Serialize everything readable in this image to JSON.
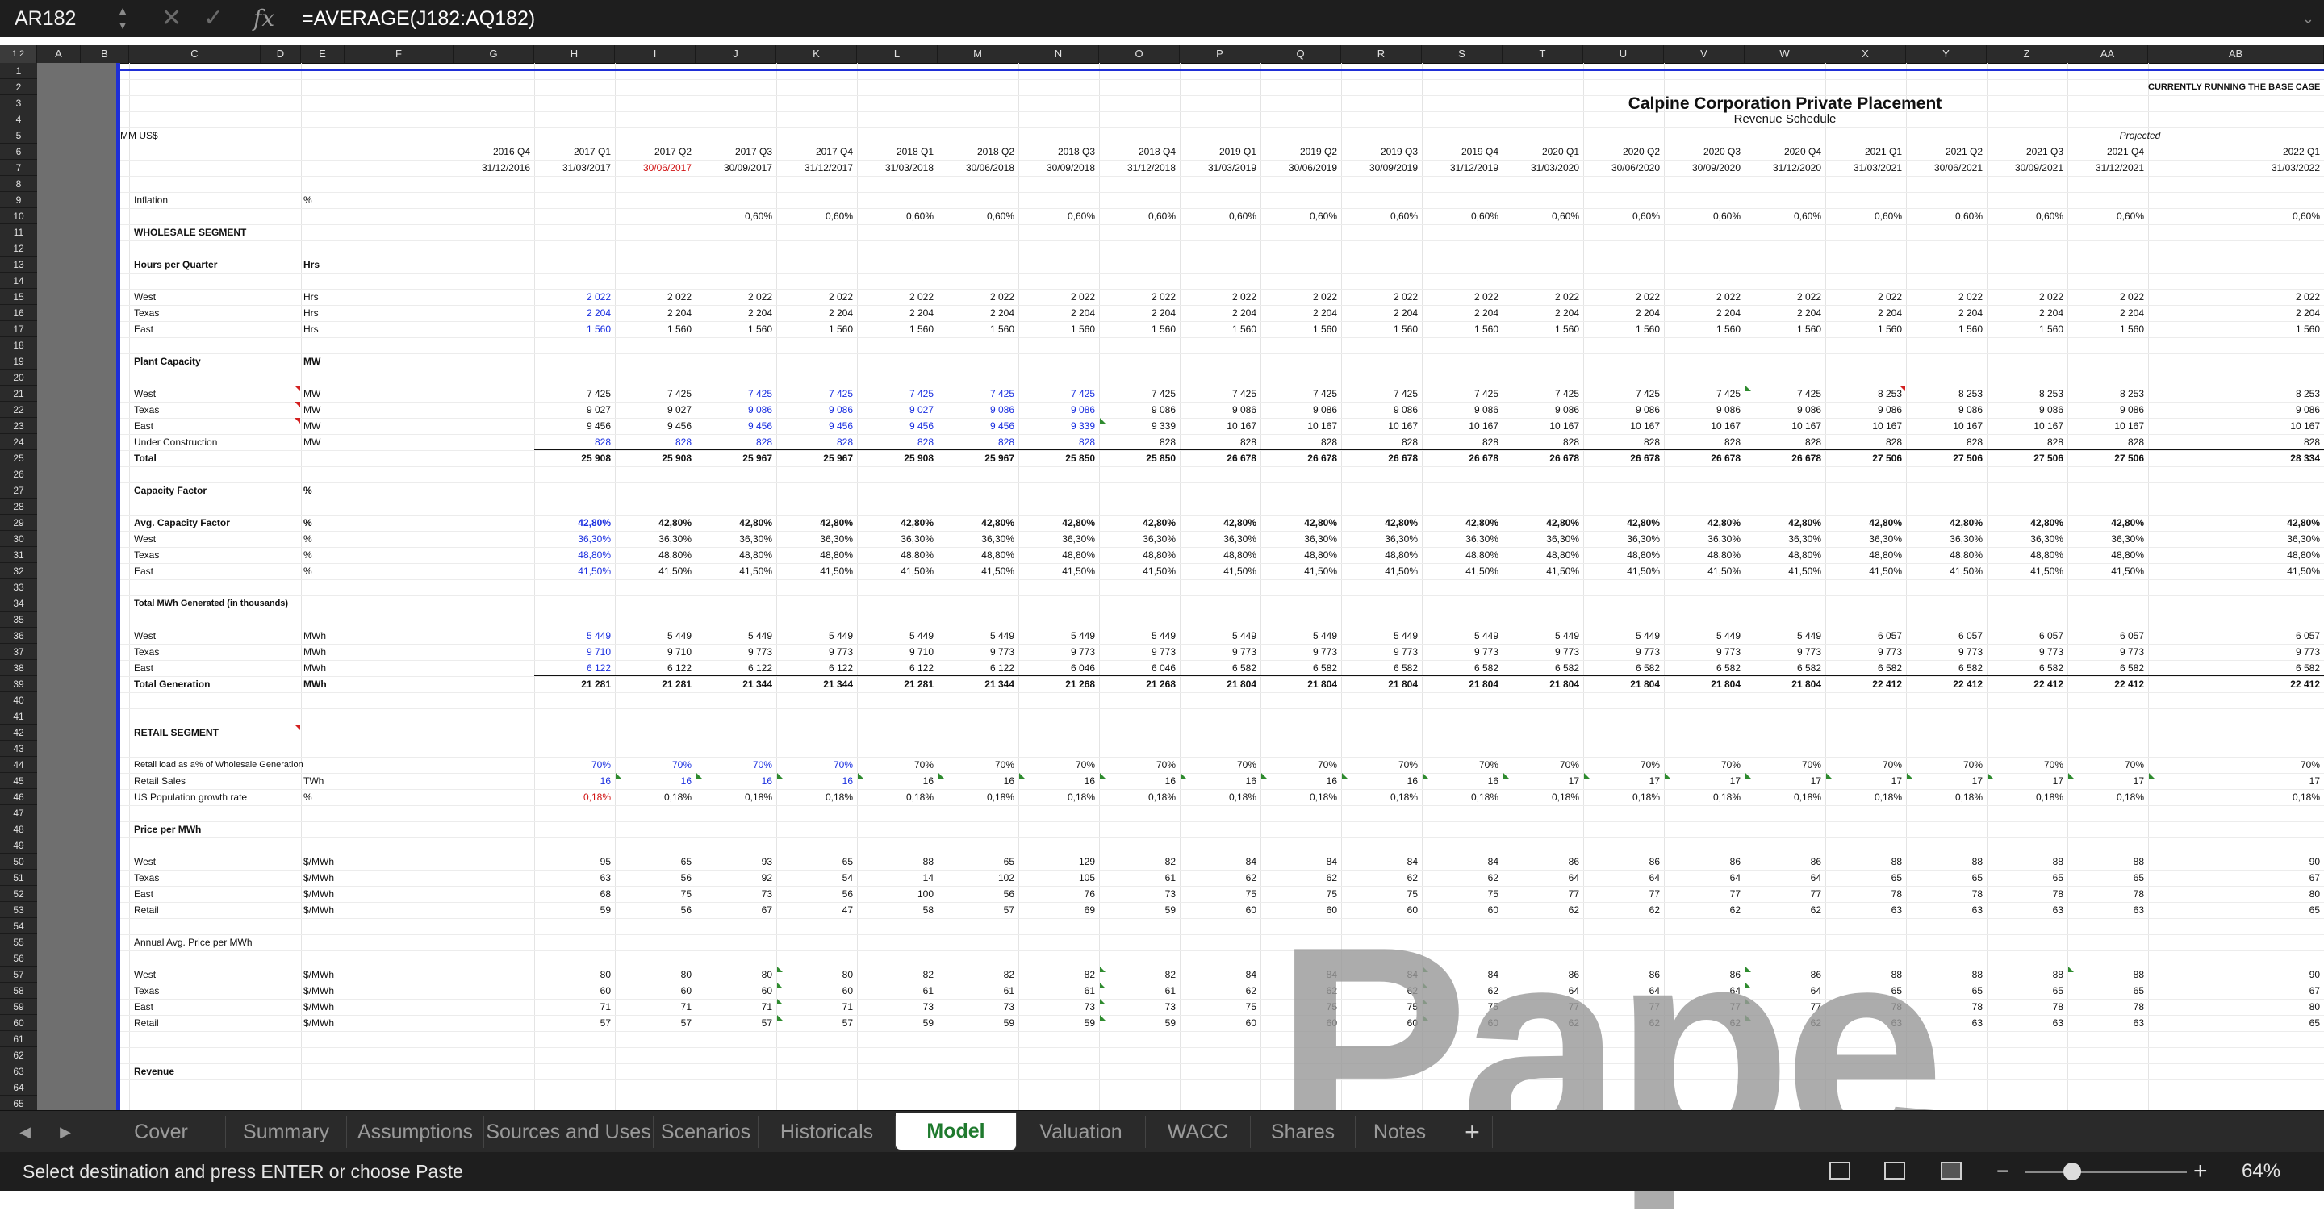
{
  "formula_bar": {
    "name_box": "AR182",
    "fx_label": "fx",
    "formula": "=AVERAGE(J182:AQ182)",
    "cancel_icon": "x-icon",
    "confirm_icon": "check-icon"
  },
  "outline_levels": "1 2",
  "columns": [
    "A",
    "B",
    "C",
    "D",
    "E",
    "F",
    "G",
    "H",
    "I",
    "J",
    "K",
    "L",
    "M",
    "N",
    "O",
    "P",
    "Q",
    "R",
    "S",
    "T",
    "U",
    "V",
    "W",
    "X",
    "Y",
    "Z",
    "AA",
    "AB"
  ],
  "headers": {
    "banner": "CURRENTLY RUNNING THE BASE CASE",
    "company": "Calpine Corporation Private Placement",
    "schedule": "Revenue Schedule",
    "units": "MM US$",
    "projected": "Projected",
    "periods": [
      "2016 Q4",
      "2017 Q1",
      "2017 Q2",
      "2017 Q3",
      "2017 Q4",
      "2018 Q1",
      "2018 Q2",
      "2018 Q3",
      "2018 Q4",
      "2019 Q1",
      "2019 Q2",
      "2019 Q3",
      "2019 Q4",
      "2020 Q1",
      "2020 Q2",
      "2020 Q3",
      "2020 Q4",
      "2021 Q1",
      "2021 Q2",
      "2021 Q3",
      "2021 Q4",
      "2022 Q1"
    ],
    "dates": [
      "31/12/2016",
      "31/03/2017",
      "30/06/2017",
      "30/09/2017",
      "31/12/2017",
      "31/03/2018",
      "30/06/2018",
      "30/09/2018",
      "31/12/2018",
      "31/03/2019",
      "30/06/2019",
      "30/09/2019",
      "31/12/2019",
      "31/03/2020",
      "30/06/2020",
      "30/09/2020",
      "31/12/2020",
      "31/03/2021",
      "30/06/2021",
      "30/09/2021",
      "31/12/2021",
      "31/03/2022"
    ]
  },
  "rows": [
    {
      "r": 9,
      "label": "Inflation",
      "unit": "%"
    },
    {
      "r": 10,
      "values": [
        "",
        "",
        "",
        "0,60%",
        "0,60%",
        "0,60%",
        "0,60%",
        "0,60%",
        "0,60%",
        "0,60%",
        "0,60%",
        "0,60%",
        "0,60%",
        "0,60%",
        "0,60%",
        "0,60%",
        "0,60%",
        "0,60%",
        "0,60%",
        "0,60%",
        "0,60%",
        "0,60%"
      ]
    },
    {
      "r": 11,
      "label": "WHOLESALE SEGMENT",
      "bold": true
    },
    {
      "r": 13,
      "label": "Hours per Quarter",
      "unit": "Hrs",
      "bold": true
    },
    {
      "r": 15,
      "label": "West",
      "unit": "Hrs",
      "values": [
        "",
        "2 022",
        "2 022",
        "2 022",
        "2 022",
        "2 022",
        "2 022",
        "2 022",
        "2 022",
        "2 022",
        "2 022",
        "2 022",
        "2 022",
        "2 022",
        "2 022",
        "2 022",
        "2 022",
        "2 022",
        "2 022",
        "2 022",
        "2 022",
        "2 022"
      ],
      "blue": [
        1
      ]
    },
    {
      "r": 16,
      "label": "Texas",
      "unit": "Hrs",
      "values": [
        "",
        "2 204",
        "2 204",
        "2 204",
        "2 204",
        "2 204",
        "2 204",
        "2 204",
        "2 204",
        "2 204",
        "2 204",
        "2 204",
        "2 204",
        "2 204",
        "2 204",
        "2 204",
        "2 204",
        "2 204",
        "2 204",
        "2 204",
        "2 204",
        "2 204"
      ],
      "blue": [
        1
      ]
    },
    {
      "r": 17,
      "label": "East",
      "unit": "Hrs",
      "values": [
        "",
        "1 560",
        "1 560",
        "1 560",
        "1 560",
        "1 560",
        "1 560",
        "1 560",
        "1 560",
        "1 560",
        "1 560",
        "1 560",
        "1 560",
        "1 560",
        "1 560",
        "1 560",
        "1 560",
        "1 560",
        "1 560",
        "1 560",
        "1 560",
        "1 560"
      ],
      "blue": [
        1
      ]
    },
    {
      "r": 19,
      "label": "Plant Capacity",
      "unit": "MW",
      "bold": true
    },
    {
      "r": 21,
      "label": "West",
      "unit": "MW",
      "values": [
        "",
        "7 425",
        "7 425",
        "7 425",
        "7 425",
        "7 425",
        "7 425",
        "7 425",
        "7 425",
        "7 425",
        "7 425",
        "7 425",
        "7 425",
        "7 425",
        "7 425",
        "7 425",
        "7 425",
        "8 253",
        "8 253",
        "8 253",
        "8 253",
        "8 253"
      ],
      "blue": [
        3,
        4,
        5,
        6,
        7
      ]
    },
    {
      "r": 22,
      "label": "Texas",
      "unit": "MW",
      "values": [
        "",
        "9 027",
        "9 027",
        "9 086",
        "9 086",
        "9 027",
        "9 086",
        "9 086",
        "9 086",
        "9 086",
        "9 086",
        "9 086",
        "9 086",
        "9 086",
        "9 086",
        "9 086",
        "9 086",
        "9 086",
        "9 086",
        "9 086",
        "9 086",
        "9 086"
      ],
      "blue": [
        3,
        4,
        5,
        6,
        7
      ]
    },
    {
      "r": 23,
      "label": "East",
      "unit": "MW",
      "values": [
        "",
        "9 456",
        "9 456",
        "9 456",
        "9 456",
        "9 456",
        "9 456",
        "9 339",
        "9 339",
        "10 167",
        "10 167",
        "10 167",
        "10 167",
        "10 167",
        "10 167",
        "10 167",
        "10 167",
        "10 167",
        "10 167",
        "10 167",
        "10 167",
        "10 167"
      ],
      "blue": [
        3,
        4,
        5,
        6,
        7
      ]
    },
    {
      "r": 24,
      "label": "Under Construction",
      "unit": "MW",
      "values": [
        "",
        "828",
        "828",
        "828",
        "828",
        "828",
        "828",
        "828",
        "828",
        "828",
        "828",
        "828",
        "828",
        "828",
        "828",
        "828",
        "828",
        "828",
        "828",
        "828",
        "828",
        "828"
      ],
      "blue": [
        1,
        2,
        3,
        4,
        5,
        6,
        7
      ]
    },
    {
      "r": 25,
      "label": "Total",
      "bold": true,
      "values": [
        "",
        "25 908",
        "25 908",
        "25 967",
        "25 967",
        "25 908",
        "25 967",
        "25 850",
        "25 850",
        "26 678",
        "26 678",
        "26 678",
        "26 678",
        "26 678",
        "26 678",
        "26 678",
        "26 678",
        "27 506",
        "27 506",
        "27 506",
        "27 506",
        "28 334"
      ]
    },
    {
      "r": 27,
      "label": "Capacity Factor",
      "unit": "%",
      "bold": true
    },
    {
      "r": 29,
      "label": "Avg. Capacity Factor",
      "unit": "%",
      "bold": true,
      "values": [
        "",
        "42,80%",
        "42,80%",
        "42,80%",
        "42,80%",
        "42,80%",
        "42,80%",
        "42,80%",
        "42,80%",
        "42,80%",
        "42,80%",
        "42,80%",
        "42,80%",
        "42,80%",
        "42,80%",
        "42,80%",
        "42,80%",
        "42,80%",
        "42,80%",
        "42,80%",
        "42,80%",
        "42,80%"
      ],
      "blue": [
        1
      ]
    },
    {
      "r": 30,
      "label": "West",
      "unit": "%",
      "values": [
        "",
        "36,30%",
        "36,30%",
        "36,30%",
        "36,30%",
        "36,30%",
        "36,30%",
        "36,30%",
        "36,30%",
        "36,30%",
        "36,30%",
        "36,30%",
        "36,30%",
        "36,30%",
        "36,30%",
        "36,30%",
        "36,30%",
        "36,30%",
        "36,30%",
        "36,30%",
        "36,30%",
        "36,30%"
      ],
      "blue": [
        1
      ]
    },
    {
      "r": 31,
      "label": "Texas",
      "unit": "%",
      "values": [
        "",
        "48,80%",
        "48,80%",
        "48,80%",
        "48,80%",
        "48,80%",
        "48,80%",
        "48,80%",
        "48,80%",
        "48,80%",
        "48,80%",
        "48,80%",
        "48,80%",
        "48,80%",
        "48,80%",
        "48,80%",
        "48,80%",
        "48,80%",
        "48,80%",
        "48,80%",
        "48,80%",
        "48,80%"
      ],
      "blue": [
        1
      ]
    },
    {
      "r": 32,
      "label": "East",
      "unit": "%",
      "values": [
        "",
        "41,50%",
        "41,50%",
        "41,50%",
        "41,50%",
        "41,50%",
        "41,50%",
        "41,50%",
        "41,50%",
        "41,50%",
        "41,50%",
        "41,50%",
        "41,50%",
        "41,50%",
        "41,50%",
        "41,50%",
        "41,50%",
        "41,50%",
        "41,50%",
        "41,50%",
        "41,50%",
        "41,50%"
      ],
      "blue": [
        1
      ]
    },
    {
      "r": 34,
      "label": "Total MWh Generated (in thousands)",
      "bold": true
    },
    {
      "r": 36,
      "label": "West",
      "unit": "MWh",
      "values": [
        "",
        "5 449",
        "5 449",
        "5 449",
        "5 449",
        "5 449",
        "5 449",
        "5 449",
        "5 449",
        "5 449",
        "5 449",
        "5 449",
        "5 449",
        "5 449",
        "5 449",
        "5 449",
        "5 449",
        "6 057",
        "6 057",
        "6 057",
        "6 057",
        "6 057"
      ],
      "blue": [
        1
      ]
    },
    {
      "r": 37,
      "label": "Texas",
      "unit": "MWh",
      "values": [
        "",
        "9 710",
        "9 710",
        "9 773",
        "9 773",
        "9 710",
        "9 773",
        "9 773",
        "9 773",
        "9 773",
        "9 773",
        "9 773",
        "9 773",
        "9 773",
        "9 773",
        "9 773",
        "9 773",
        "9 773",
        "9 773",
        "9 773",
        "9 773",
        "9 773"
      ],
      "blue": [
        1
      ]
    },
    {
      "r": 38,
      "label": "East",
      "unit": "MWh",
      "values": [
        "",
        "6 122",
        "6 122",
        "6 122",
        "6 122",
        "6 122",
        "6 122",
        "6 046",
        "6 046",
        "6 582",
        "6 582",
        "6 582",
        "6 582",
        "6 582",
        "6 582",
        "6 582",
        "6 582",
        "6 582",
        "6 582",
        "6 582",
        "6 582",
        "6 582"
      ],
      "blue": [
        1
      ]
    },
    {
      "r": 39,
      "label": "Total Generation",
      "unit": "MWh",
      "bold": true,
      "values": [
        "",
        "21 281",
        "21 281",
        "21 344",
        "21 344",
        "21 281",
        "21 344",
        "21 268",
        "21 268",
        "21 804",
        "21 804",
        "21 804",
        "21 804",
        "21 804",
        "21 804",
        "21 804",
        "21 804",
        "22 412",
        "22 412",
        "22 412",
        "22 412",
        "22 412"
      ]
    },
    {
      "r": 42,
      "label": "RETAIL SEGMENT",
      "bold": true
    },
    {
      "r": 44,
      "label": "Retail load as a% of Wholesale Generation",
      "values": [
        "",
        "70%",
        "70%",
        "70%",
        "70%",
        "70%",
        "70%",
        "70%",
        "70%",
        "70%",
        "70%",
        "70%",
        "70%",
        "70%",
        "70%",
        "70%",
        "70%",
        "70%",
        "70%",
        "70%",
        "70%",
        "70%"
      ],
      "blue": [
        1,
        2,
        3,
        4
      ]
    },
    {
      "r": 45,
      "label": "Retail Sales",
      "unit": "TWh",
      "values": [
        "",
        "16",
        "16",
        "16",
        "16",
        "16",
        "16",
        "16",
        "16",
        "16",
        "16",
        "16",
        "16",
        "17",
        "17",
        "17",
        "17",
        "17",
        "17",
        "17",
        "17",
        "17"
      ],
      "blue": [
        1,
        2,
        3,
        4
      ]
    },
    {
      "r": 46,
      "label": "US Population growth rate",
      "unit": "%",
      "values": [
        "",
        "0,18%",
        "0,18%",
        "0,18%",
        "0,18%",
        "0,18%",
        "0,18%",
        "0,18%",
        "0,18%",
        "0,18%",
        "0,18%",
        "0,18%",
        "0,18%",
        "0,18%",
        "0,18%",
        "0,18%",
        "0,18%",
        "0,18%",
        "0,18%",
        "0,18%",
        "0,18%",
        "0,18%"
      ],
      "red": [
        1
      ]
    },
    {
      "r": 48,
      "label": "Price per MWh",
      "bold": true
    },
    {
      "r": 50,
      "label": "West",
      "unit": "$/MWh",
      "values": [
        "",
        "95",
        "65",
        "93",
        "65",
        "88",
        "65",
        "129",
        "82",
        "84",
        "84",
        "84",
        "84",
        "86",
        "86",
        "86",
        "86",
        "88",
        "88",
        "88",
        "88",
        "90"
      ]
    },
    {
      "r": 51,
      "label": "Texas",
      "unit": "$/MWh",
      "values": [
        "",
        "63",
        "56",
        "92",
        "54",
        "14",
        "102",
        "105",
        "61",
        "62",
        "62",
        "62",
        "62",
        "64",
        "64",
        "64",
        "64",
        "65",
        "65",
        "65",
        "65",
        "67"
      ]
    },
    {
      "r": 52,
      "label": "East",
      "unit": "$/MWh",
      "values": [
        "",
        "68",
        "75",
        "73",
        "56",
        "100",
        "56",
        "76",
        "73",
        "75",
        "75",
        "75",
        "75",
        "77",
        "77",
        "77",
        "77",
        "78",
        "78",
        "78",
        "78",
        "80"
      ]
    },
    {
      "r": 53,
      "label": "Retail",
      "unit": "$/MWh",
      "values": [
        "",
        "59",
        "56",
        "67",
        "47",
        "58",
        "57",
        "69",
        "59",
        "60",
        "60",
        "60",
        "60",
        "62",
        "62",
        "62",
        "62",
        "63",
        "63",
        "63",
        "63",
        "65"
      ]
    },
    {
      "r": 55,
      "label": "Annual Avg. Price per MWh"
    },
    {
      "r": 57,
      "label": "West",
      "unit": "$/MWh",
      "values": [
        "",
        "80",
        "80",
        "80",
        "80",
        "82",
        "82",
        "82",
        "82",
        "84",
        "84",
        "84",
        "84",
        "86",
        "86",
        "86",
        "86",
        "88",
        "88",
        "88",
        "88",
        "90"
      ]
    },
    {
      "r": 58,
      "label": "Texas",
      "unit": "$/MWh",
      "values": [
        "",
        "60",
        "60",
        "60",
        "60",
        "61",
        "61",
        "61",
        "61",
        "62",
        "62",
        "62",
        "62",
        "64",
        "64",
        "64",
        "64",
        "65",
        "65",
        "65",
        "65",
        "67"
      ]
    },
    {
      "r": 59,
      "label": "East",
      "unit": "$/MWh",
      "values": [
        "",
        "71",
        "71",
        "71",
        "71",
        "73",
        "73",
        "73",
        "73",
        "75",
        "75",
        "75",
        "75",
        "77",
        "77",
        "77",
        "77",
        "78",
        "78",
        "78",
        "78",
        "80"
      ]
    },
    {
      "r": 60,
      "label": "Retail",
      "unit": "$/MWh",
      "values": [
        "",
        "57",
        "57",
        "57",
        "57",
        "59",
        "59",
        "59",
        "59",
        "60",
        "60",
        "60",
        "60",
        "62",
        "62",
        "62",
        "62",
        "63",
        "63",
        "63",
        "63",
        "65"
      ]
    },
    {
      "r": 63,
      "label": "Revenue",
      "bold": true
    }
  ],
  "watermark": "Pape",
  "sheet_tabs": [
    "Cover",
    "Summary",
    "Assumptions",
    "Sources and Uses",
    "Scenarios",
    "Historicals",
    "Model",
    "Valuation",
    "WACC",
    "Shares",
    "Notes"
  ],
  "active_tab": "Model",
  "add_sheet": "+",
  "status_message": "Select destination and press ENTER or choose Paste",
  "zoom": "64%",
  "zoom_minus": "−",
  "zoom_plus": "+",
  "view_icons": [
    "normal-view-icon",
    "page-layout-icon",
    "page-break-icon"
  ]
}
